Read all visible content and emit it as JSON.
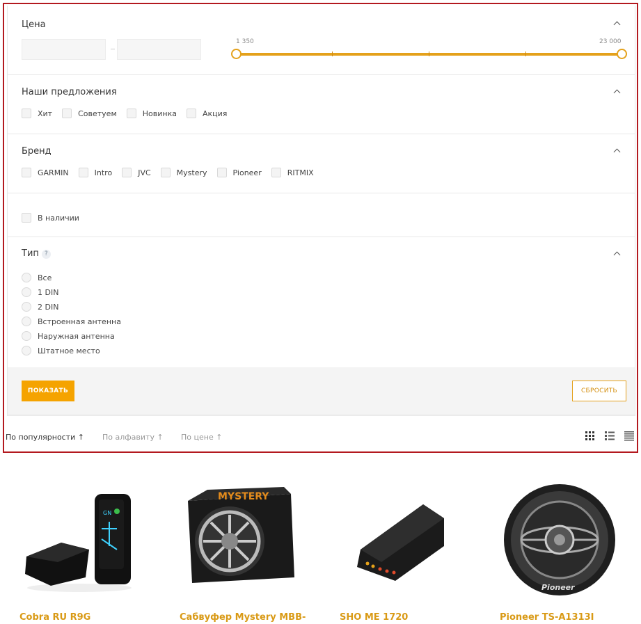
{
  "filters": {
    "price": {
      "title": "Цена",
      "min_label": "1 350",
      "max_label": "23 000",
      "min_value": 1350,
      "max_value": 23000,
      "range_min": 1350,
      "range_max": 23000
    },
    "offers": {
      "title": "Наши предложения",
      "options": [
        "Хит",
        "Советуем",
        "Новинка",
        "Акция"
      ]
    },
    "brand": {
      "title": "Бренд",
      "options": [
        "GARMIN",
        "Intro",
        "JVC",
        "Mystery",
        "Pioneer",
        "RITMIX"
      ]
    },
    "availability": {
      "label": "В наличии"
    },
    "type": {
      "title": "Тип",
      "help": "?",
      "options": [
        "Все",
        "1 DIN",
        "2 DIN",
        "Встроенная антенна",
        "Наружная антенна",
        "Штатное место"
      ]
    },
    "show_button": "ПОКАЗАТЬ",
    "reset_button": "СБРОСИТЬ"
  },
  "sort": {
    "popularity": "По популярности",
    "alphabet": "По алфавиту",
    "price": "По цене",
    "active_arrow": "↑",
    "inactive_arrow": "↑"
  },
  "products": [
    {
      "name": "Cobra RU R9G"
    },
    {
      "name": "Сабвуфер Mystery MBB-"
    },
    {
      "name": "SHO ME 1720"
    },
    {
      "name": "Pioneer TS-A1313I"
    }
  ],
  "colors": {
    "accent": "#f5a300",
    "frame": "#b3191f",
    "product_name": "#d99a16"
  }
}
